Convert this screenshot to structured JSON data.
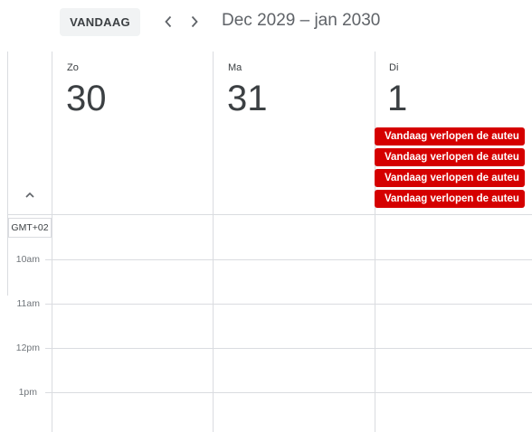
{
  "toolbar": {
    "today_label": "VANDAAG",
    "date_range": "Dec 2029 – jan 2030"
  },
  "days": [
    {
      "abbr": "Zo",
      "num": "30"
    },
    {
      "abbr": "Ma",
      "num": "31"
    },
    {
      "abbr": "Di",
      "num": "1"
    }
  ],
  "events": [
    {
      "label": "Vandaag verlopen de auteu"
    },
    {
      "label": "Vandaag verlopen de auteu"
    },
    {
      "label": "Vandaag verlopen de auteu"
    },
    {
      "label": "Vandaag verlopen de auteu"
    }
  ],
  "timezone": "GMT+02",
  "times": [
    "10am",
    "11am",
    "12pm",
    "1pm"
  ],
  "colors": {
    "event": "#d50000",
    "grid": "#dadce0"
  }
}
